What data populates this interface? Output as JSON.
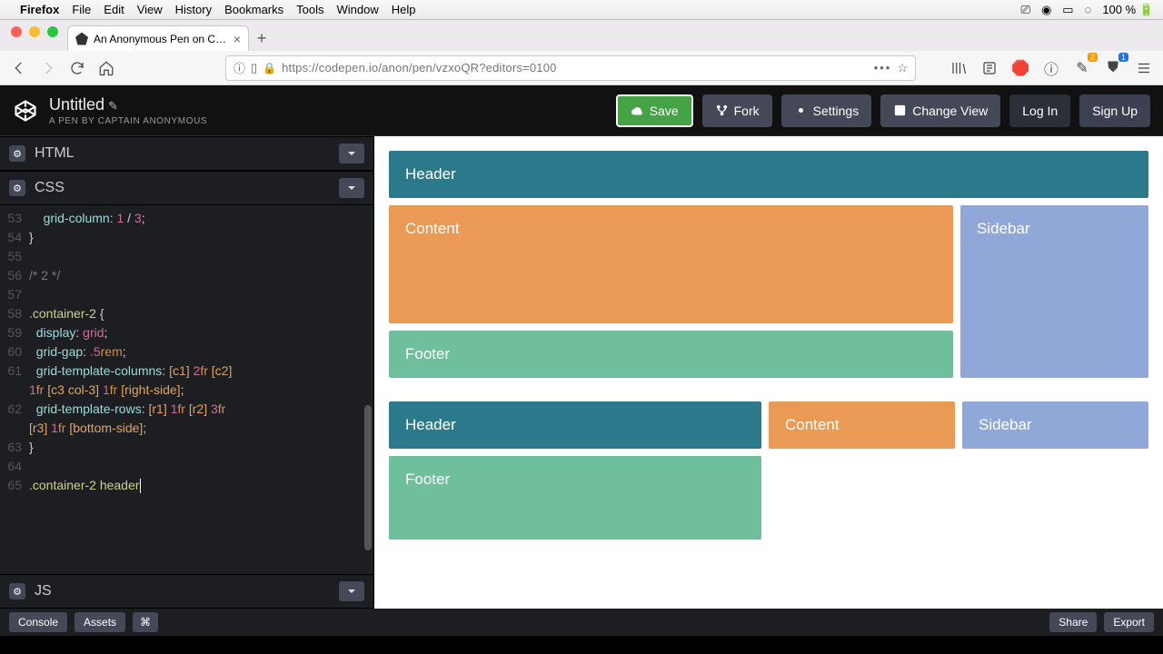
{
  "menubar": {
    "app": "Firefox",
    "items": [
      "File",
      "Edit",
      "View",
      "History",
      "Bookmarks",
      "Tools",
      "Window",
      "Help"
    ],
    "battery": "100 %"
  },
  "browser": {
    "tab_title": "An Anonymous Pen on CodePe",
    "url": "https://codepen.io/anon/pen/vzxoQR?editors=0100",
    "ext_badge1": "2",
    "ext_badge2": "1"
  },
  "codepen": {
    "title": "Untitled",
    "subtitle": "A PEN BY CAPTAIN ANONYMOUS",
    "buttons": {
      "save": "Save",
      "fork": "Fork",
      "settings": "Settings",
      "changeview": "Change View",
      "login": "Log In",
      "signup": "Sign Up"
    },
    "footer": {
      "console": "Console",
      "assets": "Assets",
      "shortcuts": "⌘",
      "share": "Share",
      "export": "Export"
    },
    "panels": {
      "html": "HTML",
      "css": "CSS",
      "js": "JS"
    },
    "css_code": {
      "l53": "    grid-column: 1 / 3;",
      "l54": "}",
      "l56": "/* 2 */",
      "l58": ".container-2 {",
      "l59": "  display: grid;",
      "l60": "  grid-gap: .5rem;",
      "l61a": "  grid-template-columns: [c1] 2fr [c2]",
      "l61b": "1fr [c3 col-3] 1fr [right-side];",
      "l62a": "  grid-template-rows: [r1] 1fr [r2] 3fr",
      "l62b": "[r3] 1fr [bottom-side];",
      "l63": "}",
      "l65": ".container-2 header"
    }
  },
  "preview": {
    "labels": {
      "header": "Header",
      "content": "Content",
      "sidebar": "Sidebar",
      "footer": "Footer"
    }
  }
}
